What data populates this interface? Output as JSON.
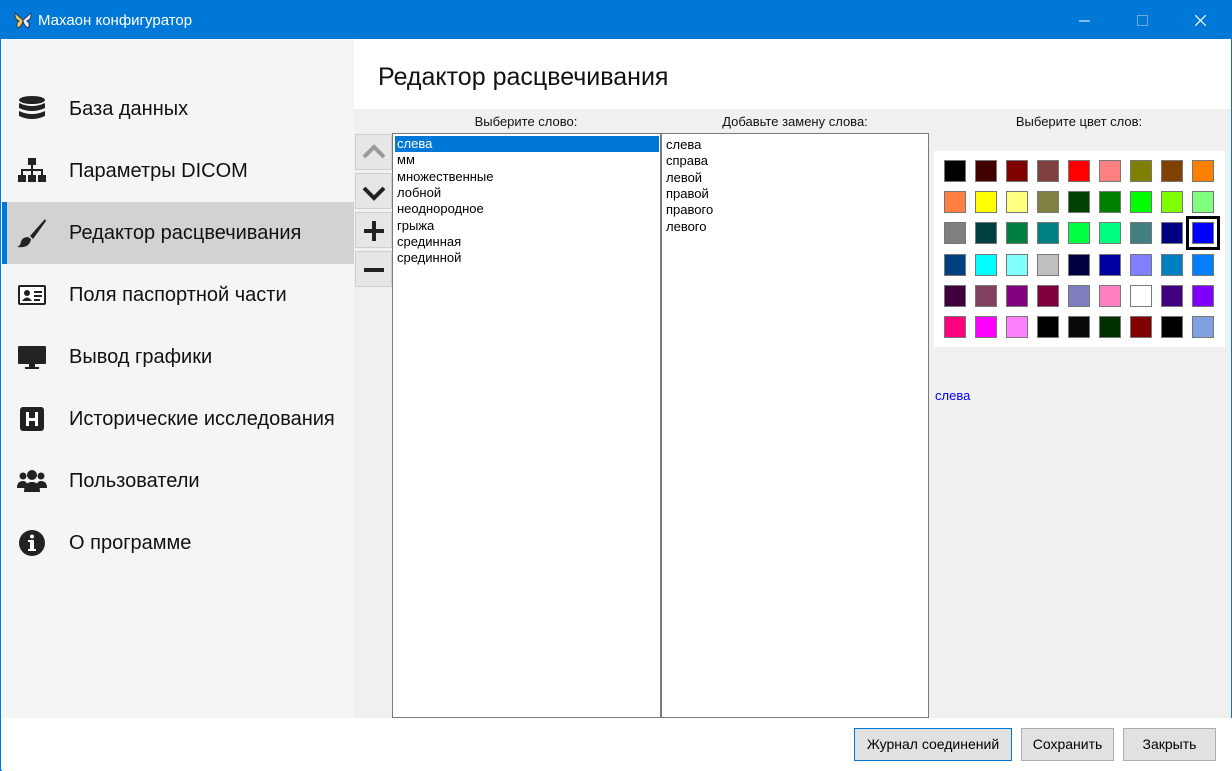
{
  "window": {
    "title": "Махаон конфигуратор"
  },
  "sidebar": {
    "items": [
      {
        "label": "База данных",
        "icon": "database-icon"
      },
      {
        "label": "Параметры DICOM",
        "icon": "sitemap-icon"
      },
      {
        "label": "Редактор расцвечивания",
        "icon": "paintbrush-icon",
        "active": true
      },
      {
        "label": "Поля паспортной части",
        "icon": "id-card-icon"
      },
      {
        "label": "Вывод графики",
        "icon": "monitor-icon"
      },
      {
        "label": "Исторические исследования",
        "icon": "hospital-icon"
      },
      {
        "label": "Пользователи",
        "icon": "users-icon"
      },
      {
        "label": "О программе",
        "icon": "info-icon"
      }
    ]
  },
  "main": {
    "title": "Редактор расцвечивания",
    "col_words_label": "Выберите слово:",
    "col_replacements_label": "Добавьте замену слова:",
    "col_colors_label": "Выберите цвет слов:",
    "words": [
      "слева",
      "мм",
      "множественные",
      "лобной",
      "неоднородное",
      "грыжа",
      "срединная",
      "срединной"
    ],
    "selected_word_index": 0,
    "replacements": [
      "слева",
      "справа",
      "левой",
      "правой",
      "правого",
      "левого"
    ],
    "palette": [
      "#000000",
      "#400000",
      "#800000",
      "#804040",
      "#ff0000",
      "#ff8080",
      "#808000",
      "#804000",
      "#ff8000",
      "#ff8040",
      "#ffff00",
      "#ffff80",
      "#808040",
      "#004000",
      "#008000",
      "#00ff00",
      "#80ff00",
      "#80ff80",
      "#808080",
      "#004040",
      "#008040",
      "#008080",
      "#00ff40",
      "#00ff80",
      "#408080",
      "#000080",
      "#0000ff",
      "#004080",
      "#00ffff",
      "#80ffff",
      "#c0c0c0",
      "#000040",
      "#0000a0",
      "#8080ff",
      "#0080c0",
      "#0080ff",
      "#400040",
      "#804060",
      "#800080",
      "#800040",
      "#8080c0",
      "#ff80c0",
      "#ffffff",
      "#400080",
      "#8000ff",
      "#ff0080",
      "#ff00ff",
      "#ff80ff",
      "#000000",
      "#0a0a0a",
      "#003000",
      "#800000",
      "#000000",
      "#80a0e0"
    ],
    "selected_color_index": 26,
    "preview_word": "слева",
    "preview_color": "#0000ff"
  },
  "footer": {
    "journal_label": "Журнал соединений",
    "save_label": "Сохранить",
    "close_label": "Закрыть"
  }
}
